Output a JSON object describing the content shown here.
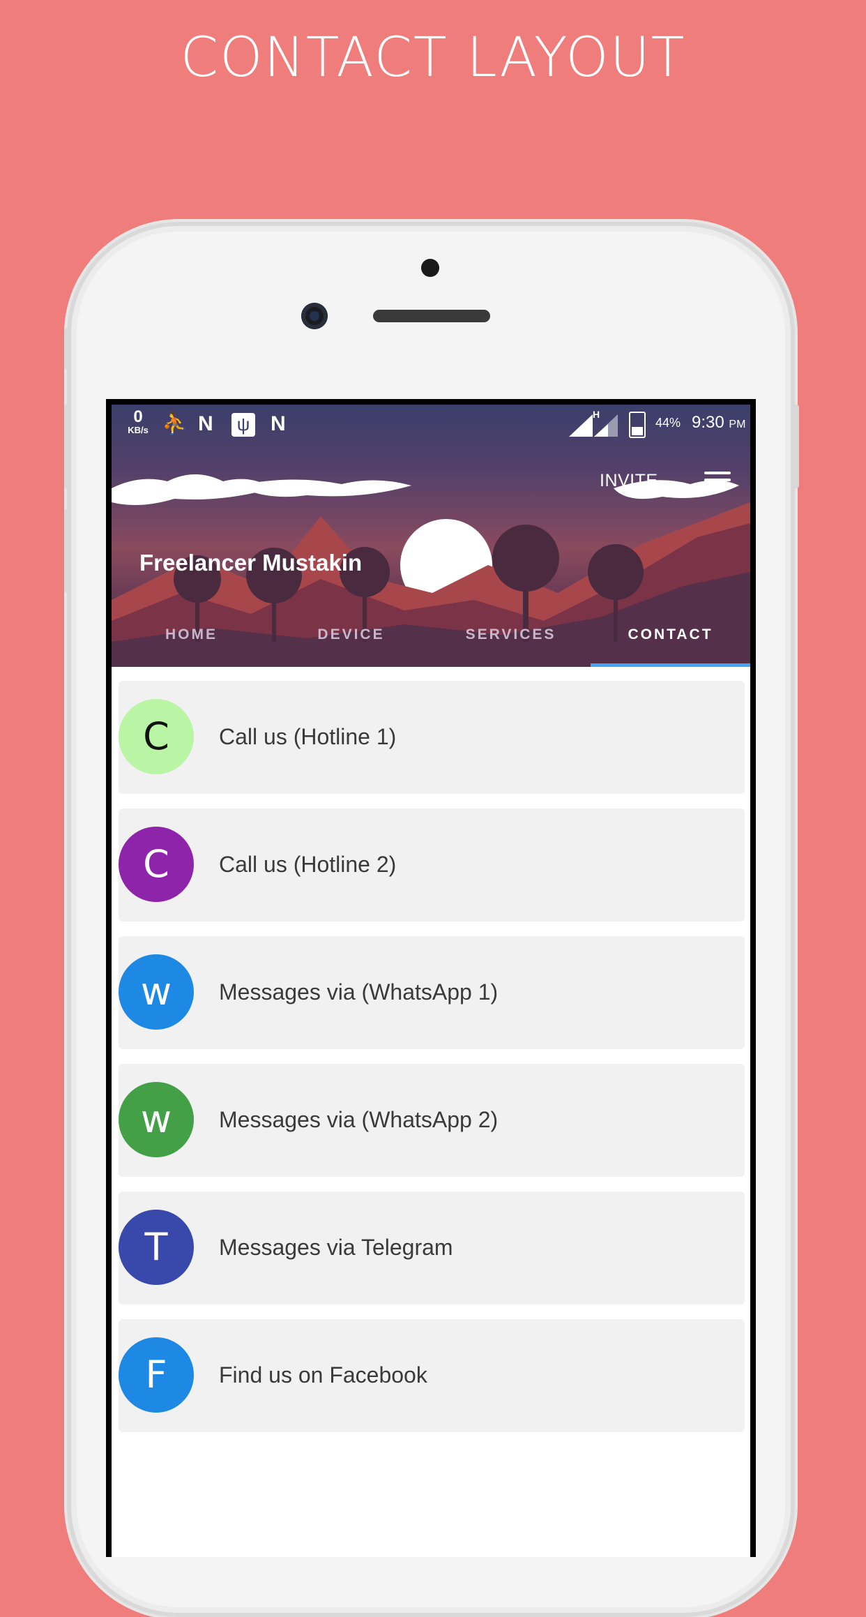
{
  "promo": {
    "title": "CONTACT LAYOUT"
  },
  "statusbar": {
    "kbs_value": "0",
    "kbs_unit": "KB/s",
    "network_label": "H",
    "battery": "44%",
    "time": "9:30",
    "ampm": "PM"
  },
  "header": {
    "invite_label": "INVITE",
    "profile_name": "Freelancer Mustakin",
    "tabs": [
      {
        "label": "HOME"
      },
      {
        "label": "DEVICE"
      },
      {
        "label": "SERVICES"
      },
      {
        "label": "CONTACT"
      }
    ],
    "active_tab": "CONTACT",
    "accent": "#3fa7f4"
  },
  "contacts": [
    {
      "initial": "C",
      "label": "Call us (Hotline 1)",
      "color": "#b9f5a5",
      "text_color": "#111111"
    },
    {
      "initial": "C",
      "label": "Call us (Hotline 2)",
      "color": "#8e24aa",
      "text_color": "#ffffff"
    },
    {
      "initial": "w",
      "label": "Messages via (WhatsApp 1)",
      "color": "#1e88e5",
      "text_color": "#ffffff"
    },
    {
      "initial": "w",
      "label": "Messages via (WhatsApp 2)",
      "color": "#43a047",
      "text_color": "#ffffff"
    },
    {
      "initial": "T",
      "label": "Messages via Telegram",
      "color": "#3949ab",
      "text_color": "#ffffff"
    },
    {
      "initial": "F",
      "label": "Find us on Facebook",
      "color": "#1e88e5",
      "text_color": "#ffffff"
    }
  ]
}
